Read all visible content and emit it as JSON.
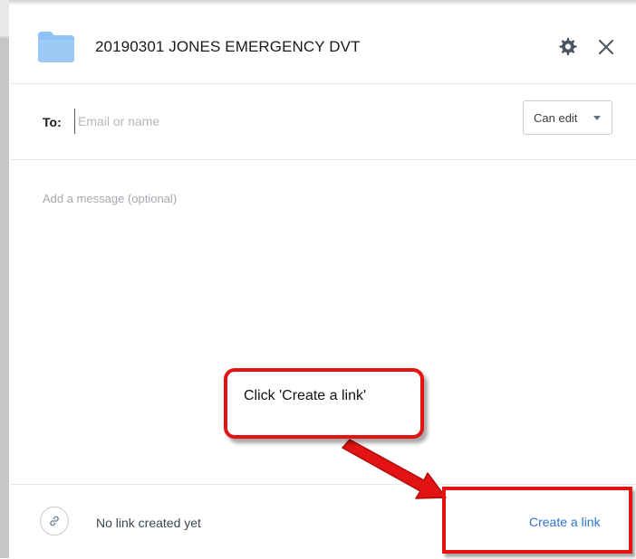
{
  "dialog": {
    "title": "20190301 JONES EMERGENCY DVT",
    "folder_color": "#8ec1f5",
    "icons": {
      "folder": "folder-icon",
      "settings": "gear-icon",
      "close": "close-icon"
    }
  },
  "share": {
    "to_label": "To:",
    "to_placeholder": "Email or name",
    "permission": "Can edit",
    "message_placeholder": "Add a message (optional)"
  },
  "footer": {
    "link_icon": "link-icon",
    "status": "No link created yet",
    "create_link_label": "Create a link",
    "link_color": "#2e74d0"
  },
  "tutorial": {
    "callout_text": "Click 'Create a link'",
    "accent": "#e31313"
  }
}
